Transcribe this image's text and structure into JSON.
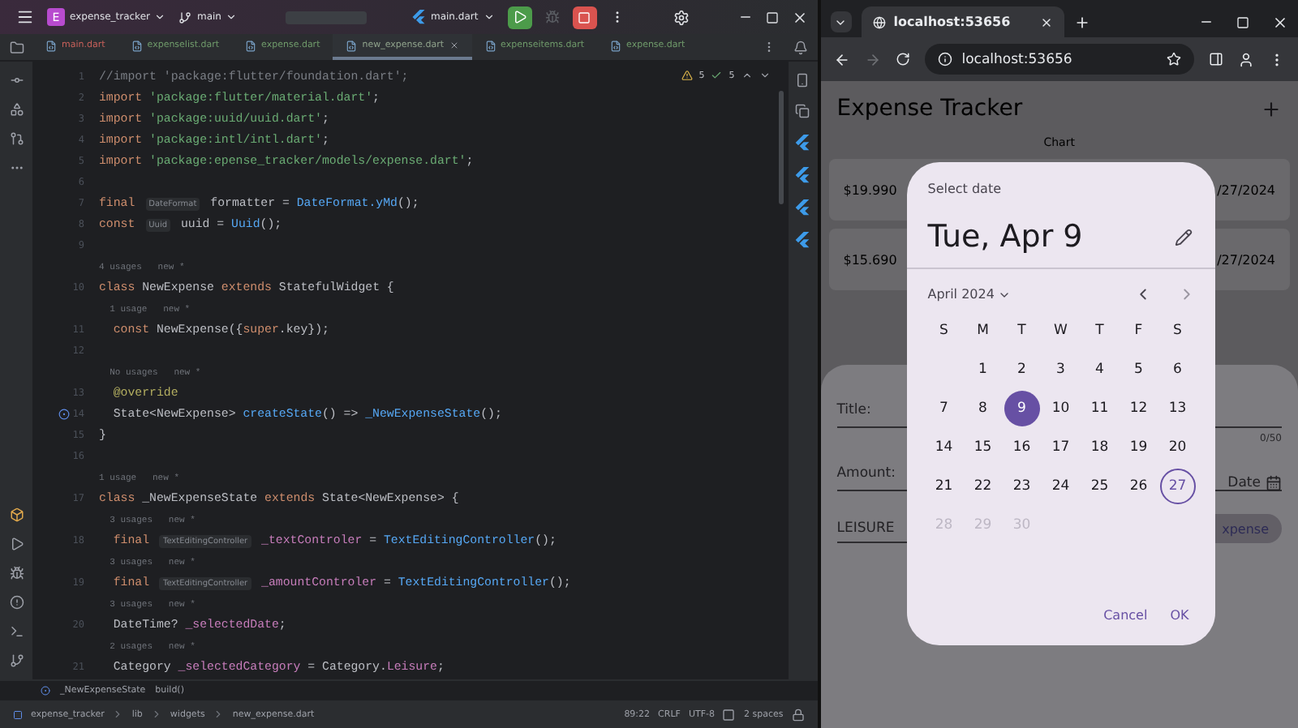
{
  "ide": {
    "toolbar": {
      "project_initial": "E",
      "project": "expense_tracker",
      "branch": "main",
      "run_config": "main.dart"
    },
    "tabs": [
      {
        "label": "main.dart",
        "selected": false,
        "color": "#c7605a"
      },
      {
        "label": "expenselist.dart",
        "selected": false,
        "color": "#6f9a6a"
      },
      {
        "label": "expense.dart",
        "selected": false,
        "color": "#6f9a6a"
      },
      {
        "label": "new_expense.dart",
        "selected": true,
        "color": "#8fa28b"
      },
      {
        "label": "expenseitems.dart",
        "selected": false,
        "color": "#6f9a6a"
      },
      {
        "label": "expense.dart",
        "selected": false,
        "color": "#6f9a6a"
      }
    ],
    "inspections": {
      "warnings": "5",
      "checks": "5"
    },
    "code": [
      {
        "kind": "code",
        "number": "1",
        "tokens": [
          {
            "kind": "comment",
            "text": "//import 'package:flutter/foundation.dart';"
          }
        ]
      },
      {
        "kind": "code",
        "number": "2",
        "tokens": [
          {
            "kind": "keyword",
            "text": "import "
          },
          {
            "kind": "string",
            "text": "'package:flutter/material.dart'"
          },
          {
            "kind": "plain",
            "text": ";"
          }
        ]
      },
      {
        "kind": "code",
        "number": "3",
        "tokens": [
          {
            "kind": "keyword",
            "text": "import "
          },
          {
            "kind": "string",
            "text": "'package:uuid/uuid.dart'"
          },
          {
            "kind": "plain",
            "text": ";"
          }
        ]
      },
      {
        "kind": "code",
        "number": "4",
        "tokens": [
          {
            "kind": "keyword",
            "text": "import "
          },
          {
            "kind": "string",
            "text": "'package:intl/intl.dart'"
          },
          {
            "kind": "plain",
            "text": ";"
          }
        ]
      },
      {
        "kind": "code",
        "number": "5",
        "tokens": [
          {
            "kind": "keyword",
            "text": "import "
          },
          {
            "kind": "string",
            "text": "'package:epense_tracker/models/expense.dart'"
          },
          {
            "kind": "plain",
            "text": ";"
          }
        ]
      },
      {
        "kind": "code",
        "number": "6"
      },
      {
        "kind": "code",
        "number": "7",
        "tokens": [
          {
            "kind": "keyword",
            "text": "final "
          },
          {
            "kind": "chip",
            "text": "DateFormat"
          },
          {
            "kind": "plain",
            "text": " formatter = "
          },
          {
            "kind": "call",
            "text": "DateFormat.yMd"
          },
          {
            "kind": "plain",
            "text": "();"
          }
        ]
      },
      {
        "kind": "code",
        "number": "8",
        "tokens": [
          {
            "kind": "keyword",
            "text": "const "
          },
          {
            "kind": "chip",
            "text": "Uuid"
          },
          {
            "kind": "plain",
            "text": " uuid = "
          },
          {
            "kind": "call",
            "text": "Uuid"
          },
          {
            "kind": "plain",
            "text": "();"
          }
        ]
      },
      {
        "kind": "code",
        "number": "9"
      },
      {
        "kind": "hint",
        "text": "4 usages   new *"
      },
      {
        "kind": "code",
        "number": "10",
        "tokens": [
          {
            "kind": "keyword",
            "text": "class "
          },
          {
            "kind": "plain",
            "text": "NewExpense "
          },
          {
            "kind": "keyword",
            "text": "extends "
          },
          {
            "kind": "plain",
            "text": "StatefulWidget {"
          }
        ]
      },
      {
        "kind": "hint",
        "text": "  1 usage   new *"
      },
      {
        "kind": "code",
        "number": "11",
        "tokens": [
          {
            "kind": "keyword",
            "text": "  const "
          },
          {
            "kind": "plain",
            "text": "NewExpense({"
          },
          {
            "kind": "keyword",
            "text": "super"
          },
          {
            "kind": "plain",
            "text": ".key});"
          }
        ]
      },
      {
        "kind": "code",
        "number": "12"
      },
      {
        "kind": "hint",
        "text": "  No usages   new *"
      },
      {
        "kind": "code",
        "number": "13",
        "tokens": [
          {
            "kind": "annotation",
            "text": "  @override"
          }
        ]
      },
      {
        "kind": "code",
        "number": "14",
        "override_marker": true,
        "tokens": [
          {
            "kind": "plain",
            "text": "  State<NewExpense> "
          },
          {
            "kind": "call",
            "text": "createState"
          },
          {
            "kind": "plain",
            "text": "() => "
          },
          {
            "kind": "call",
            "text": "_NewExpenseState"
          },
          {
            "kind": "plain",
            "text": "();"
          }
        ]
      },
      {
        "kind": "code",
        "number": "15",
        "tokens": [
          {
            "kind": "plain",
            "text": "}"
          }
        ]
      },
      {
        "kind": "code",
        "number": "16"
      },
      {
        "kind": "hint",
        "text": "1 usage   new *"
      },
      {
        "kind": "code",
        "number": "17",
        "tokens": [
          {
            "kind": "keyword",
            "text": "class "
          },
          {
            "kind": "plain",
            "text": "_NewExpenseState "
          },
          {
            "kind": "keyword",
            "text": "extends "
          },
          {
            "kind": "plain",
            "text": "State<NewExpense> {"
          }
        ]
      },
      {
        "kind": "hint",
        "text": "  3 usages   new *"
      },
      {
        "kind": "code",
        "number": "18",
        "tokens": [
          {
            "kind": "keyword",
            "text": "  final "
          },
          {
            "kind": "chip",
            "text": "TextEditingController"
          },
          {
            "kind": "field",
            "text": " _textControler"
          },
          {
            "kind": "plain",
            "text": " = "
          },
          {
            "kind": "call",
            "text": "TextEditingController"
          },
          {
            "kind": "plain",
            "text": "();"
          }
        ]
      },
      {
        "kind": "hint",
        "text": "  3 usages   new *"
      },
      {
        "kind": "code",
        "number": "19",
        "tokens": [
          {
            "kind": "keyword",
            "text": "  final "
          },
          {
            "kind": "chip",
            "text": "TextEditingController"
          },
          {
            "kind": "field",
            "text": " _amountControler"
          },
          {
            "kind": "plain",
            "text": " = "
          },
          {
            "kind": "call",
            "text": "TextEditingController"
          },
          {
            "kind": "plain",
            "text": "();"
          }
        ]
      },
      {
        "kind": "hint",
        "text": "  3 usages   new *"
      },
      {
        "kind": "code",
        "number": "20",
        "tokens": [
          {
            "kind": "plain",
            "text": "  DateTime? "
          },
          {
            "kind": "field",
            "text": "_selectedDate"
          },
          {
            "kind": "plain",
            "text": ";"
          }
        ]
      },
      {
        "kind": "hint",
        "text": "  2 usages   new *"
      },
      {
        "kind": "code",
        "number": "21",
        "tokens": [
          {
            "kind": "plain",
            "text": "  Category "
          },
          {
            "kind": "field",
            "text": "_selectedCategory"
          },
          {
            "kind": "plain",
            "text": " = Category."
          },
          {
            "kind": "field",
            "text": "Leisure"
          },
          {
            "kind": "plain",
            "text": ";"
          }
        ]
      }
    ],
    "breadcrumb": [
      "_NewExpenseState",
      "build()"
    ],
    "status_bar": {
      "path": [
        "expense_tracker",
        "lib",
        "widgets",
        "new_expense.dart"
      ],
      "position": "89:22",
      "line_ending": "CRLF",
      "encoding": "UTF-8",
      "indent": "2 spaces"
    }
  },
  "browser": {
    "tab_title": "localhost:53656",
    "url": "localhost:53656",
    "app": {
      "title": "Expense Tracker",
      "chart_label": "Chart",
      "expenses": [
        {
          "amount": "$19.990",
          "date": "/27/2024"
        },
        {
          "amount": "$15.690",
          "date": "/27/2024"
        }
      ],
      "form": {
        "title_label": "Title:",
        "counter": "0/50",
        "amount_label": "Amount:",
        "date_label": "Date",
        "category": "LEISURE",
        "save_label": "xpense"
      }
    },
    "date_picker": {
      "heading": "Select date",
      "selected_date": "Tue, Apr 9",
      "month": "April 2024",
      "weekdays": [
        "S",
        "M",
        "T",
        "W",
        "T",
        "F",
        "S"
      ],
      "weeks": [
        {
          "kind": "leading",
          "days": [
            {
              "label": "1",
              "selected": false,
              "today": false,
              "disabled": false
            },
            {
              "label": "2",
              "selected": false,
              "today": false,
              "disabled": false
            },
            {
              "label": "3",
              "selected": false,
              "today": false,
              "disabled": false
            },
            {
              "label": "4",
              "selected": false,
              "today": false,
              "disabled": false
            },
            {
              "label": "5",
              "selected": false,
              "today": false,
              "disabled": false
            },
            {
              "label": "6",
              "selected": false,
              "today": false,
              "disabled": false
            }
          ]
        },
        {
          "kind": "full",
          "days": [
            {
              "label": "7",
              "selected": false,
              "today": false,
              "disabled": false
            },
            {
              "label": "8",
              "selected": false,
              "today": false,
              "disabled": false
            },
            {
              "label": "9",
              "selected": true,
              "today": false,
              "disabled": false
            },
            {
              "label": "10",
              "selected": false,
              "today": false,
              "disabled": false
            },
            {
              "label": "11",
              "selected": false,
              "today": false,
              "disabled": false
            },
            {
              "label": "12",
              "selected": false,
              "today": false,
              "disabled": false
            },
            {
              "label": "13",
              "selected": false,
              "today": false,
              "disabled": false
            }
          ]
        },
        {
          "kind": "full",
          "days": [
            {
              "label": "14",
              "selected": false,
              "today": false,
              "disabled": false
            },
            {
              "label": "15",
              "selected": false,
              "today": false,
              "disabled": false
            },
            {
              "label": "16",
              "selected": false,
              "today": false,
              "disabled": false
            },
            {
              "label": "17",
              "selected": false,
              "today": false,
              "disabled": false
            },
            {
              "label": "18",
              "selected": false,
              "today": false,
              "disabled": false
            },
            {
              "label": "19",
              "selected": false,
              "today": false,
              "disabled": false
            },
            {
              "label": "20",
              "selected": false,
              "today": false,
              "disabled": false
            }
          ]
        },
        {
          "kind": "full",
          "days": [
            {
              "label": "21",
              "selected": false,
              "today": false,
              "disabled": false
            },
            {
              "label": "22",
              "selected": false,
              "today": false,
              "disabled": false
            },
            {
              "label": "23",
              "selected": false,
              "today": false,
              "disabled": false
            },
            {
              "label": "24",
              "selected": false,
              "today": false,
              "disabled": false
            },
            {
              "label": "25",
              "selected": false,
              "today": false,
              "disabled": false
            },
            {
              "label": "26",
              "selected": false,
              "today": false,
              "disabled": false
            },
            {
              "label": "27",
              "selected": false,
              "today": true,
              "disabled": false
            }
          ]
        },
        {
          "kind": "trailing",
          "days": [
            {
              "label": "28",
              "selected": false,
              "today": false,
              "disabled": true
            },
            {
              "label": "29",
              "selected": false,
              "today": false,
              "disabled": true
            },
            {
              "label": "30",
              "selected": false,
              "today": false,
              "disabled": true
            }
          ]
        }
      ],
      "actions": [
        "Cancel",
        "OK"
      ]
    }
  }
}
